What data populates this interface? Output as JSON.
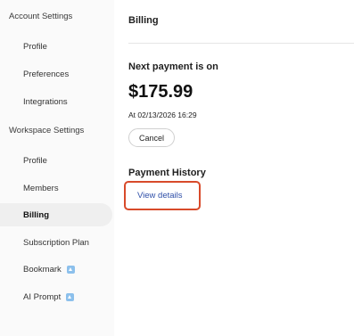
{
  "sidebar": {
    "account_header": "Account Settings",
    "account_items": [
      {
        "label": "Profile"
      },
      {
        "label": "Preferences"
      },
      {
        "label": "Integrations"
      }
    ],
    "workspace_header": "Workspace Settings",
    "workspace_items": [
      {
        "label": "Profile"
      },
      {
        "label": "Members"
      },
      {
        "label": "Billing",
        "active": true
      },
      {
        "label": "Subscription Plan"
      },
      {
        "label": "Bookmark",
        "icon": "upgrade-icon"
      },
      {
        "label": "AI Prompt",
        "icon": "upgrade-icon"
      }
    ]
  },
  "main": {
    "title": "Billing",
    "next_payment_label": "Next payment is on",
    "amount": "$175.99",
    "date_line": "At 02/13/2026 16:29",
    "cancel_label": "Cancel",
    "history_title": "Payment History",
    "view_details_label": "View details"
  },
  "colors": {
    "highlight": "#d84a2a",
    "link": "#2f4fa8",
    "upgrade_icon": "#8cc0ec",
    "active_item_bg": "#efefef"
  }
}
